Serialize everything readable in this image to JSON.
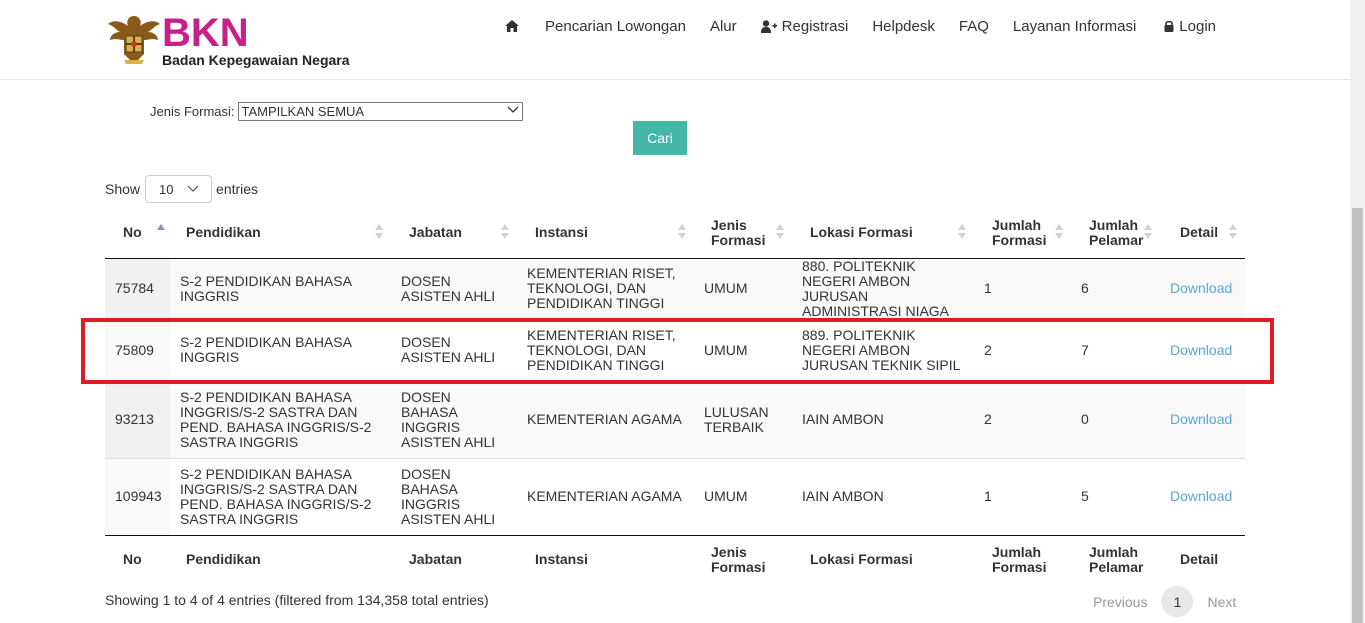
{
  "header": {
    "logo_text": "BKN",
    "logo_subtitle": "Badan Kepegawaian Negara",
    "nav": [
      {
        "label": "",
        "icon": "home-icon"
      },
      {
        "label": "Pencarian Lowongan"
      },
      {
        "label": "Alur"
      },
      {
        "label": "Registrasi",
        "icon": "user-plus-icon"
      },
      {
        "label": "Helpdesk"
      },
      {
        "label": "FAQ"
      },
      {
        "label": "Layanan Informasi"
      },
      {
        "label": "Login",
        "icon": "lock-icon"
      }
    ]
  },
  "filter": {
    "label": "Jenis Formasi:",
    "selected": "TAMPILKAN SEMUA",
    "search_button": "Cari"
  },
  "length": {
    "prefix": "Show",
    "value": "10",
    "suffix": "entries"
  },
  "table": {
    "columns": [
      "No",
      "Pendidikan",
      "Jabatan",
      "Instansi",
      "Jenis Formasi",
      "Lokasi Formasi",
      "Jumlah Formasi",
      "Jumlah Pelamar",
      "Detail"
    ],
    "rows": [
      {
        "no": "75784",
        "pendidikan": "S-2 PENDIDIKAN BAHASA INGGRIS",
        "jabatan": "DOSEN ASISTEN AHLI",
        "instansi": "KEMENTERIAN RISET, TEKNOLOGI, DAN PENDIDIKAN TINGGI",
        "jenis": "UMUM",
        "lokasi": "880. POLITEKNIK NEGERI AMBON JURUSAN ADMINISTRASI NIAGA",
        "jumlah_formasi": "1",
        "jumlah_pelamar": "6",
        "detail": "Download"
      },
      {
        "no": "75809",
        "pendidikan": "S-2 PENDIDIKAN BAHASA INGGRIS",
        "jabatan": "DOSEN ASISTEN AHLI",
        "instansi": "KEMENTERIAN RISET, TEKNOLOGI, DAN PENDIDIKAN TINGGI",
        "jenis": "UMUM",
        "lokasi": "889. POLITEKNIK NEGERI AMBON JURUSAN TEKNIK SIPIL",
        "jumlah_formasi": "2",
        "jumlah_pelamar": "7",
        "detail": "Download"
      },
      {
        "no": "93213",
        "pendidikan": "S-2 PENDIDIKAN BAHASA INGGRIS/S-2 SASTRA DAN PEND. BAHASA INGGRIS/S-2 SASTRA INGGRIS",
        "jabatan": "DOSEN BAHASA INGGRIS ASISTEN AHLI",
        "instansi": "KEMENTERIAN AGAMA",
        "jenis": "LULUSAN TERBAIK",
        "lokasi": "IAIN AMBON",
        "jumlah_formasi": "2",
        "jumlah_pelamar": "0",
        "detail": "Download"
      },
      {
        "no": "109943",
        "pendidikan": "S-2 PENDIDIKAN BAHASA INGGRIS/S-2 SASTRA DAN PEND. BAHASA INGGRIS/S-2 SASTRA INGGRIS",
        "jabatan": "DOSEN BAHASA INGGRIS ASISTEN AHLI",
        "instansi": "KEMENTERIAN AGAMA",
        "jenis": "UMUM",
        "lokasi": "IAIN AMBON",
        "jumlah_formasi": "1",
        "jumlah_pelamar": "5",
        "detail": "Download"
      }
    ]
  },
  "footer": {
    "info": "Showing 1 to 4 of 4 entries (filtered from 134,358 total entries)",
    "previous": "Previous",
    "current_page": "1",
    "next": "Next"
  },
  "colors": {
    "brand": "#c6218a",
    "button": "#45b7a8",
    "link": "#5aa6d6",
    "highlight": "#e11b22"
  }
}
